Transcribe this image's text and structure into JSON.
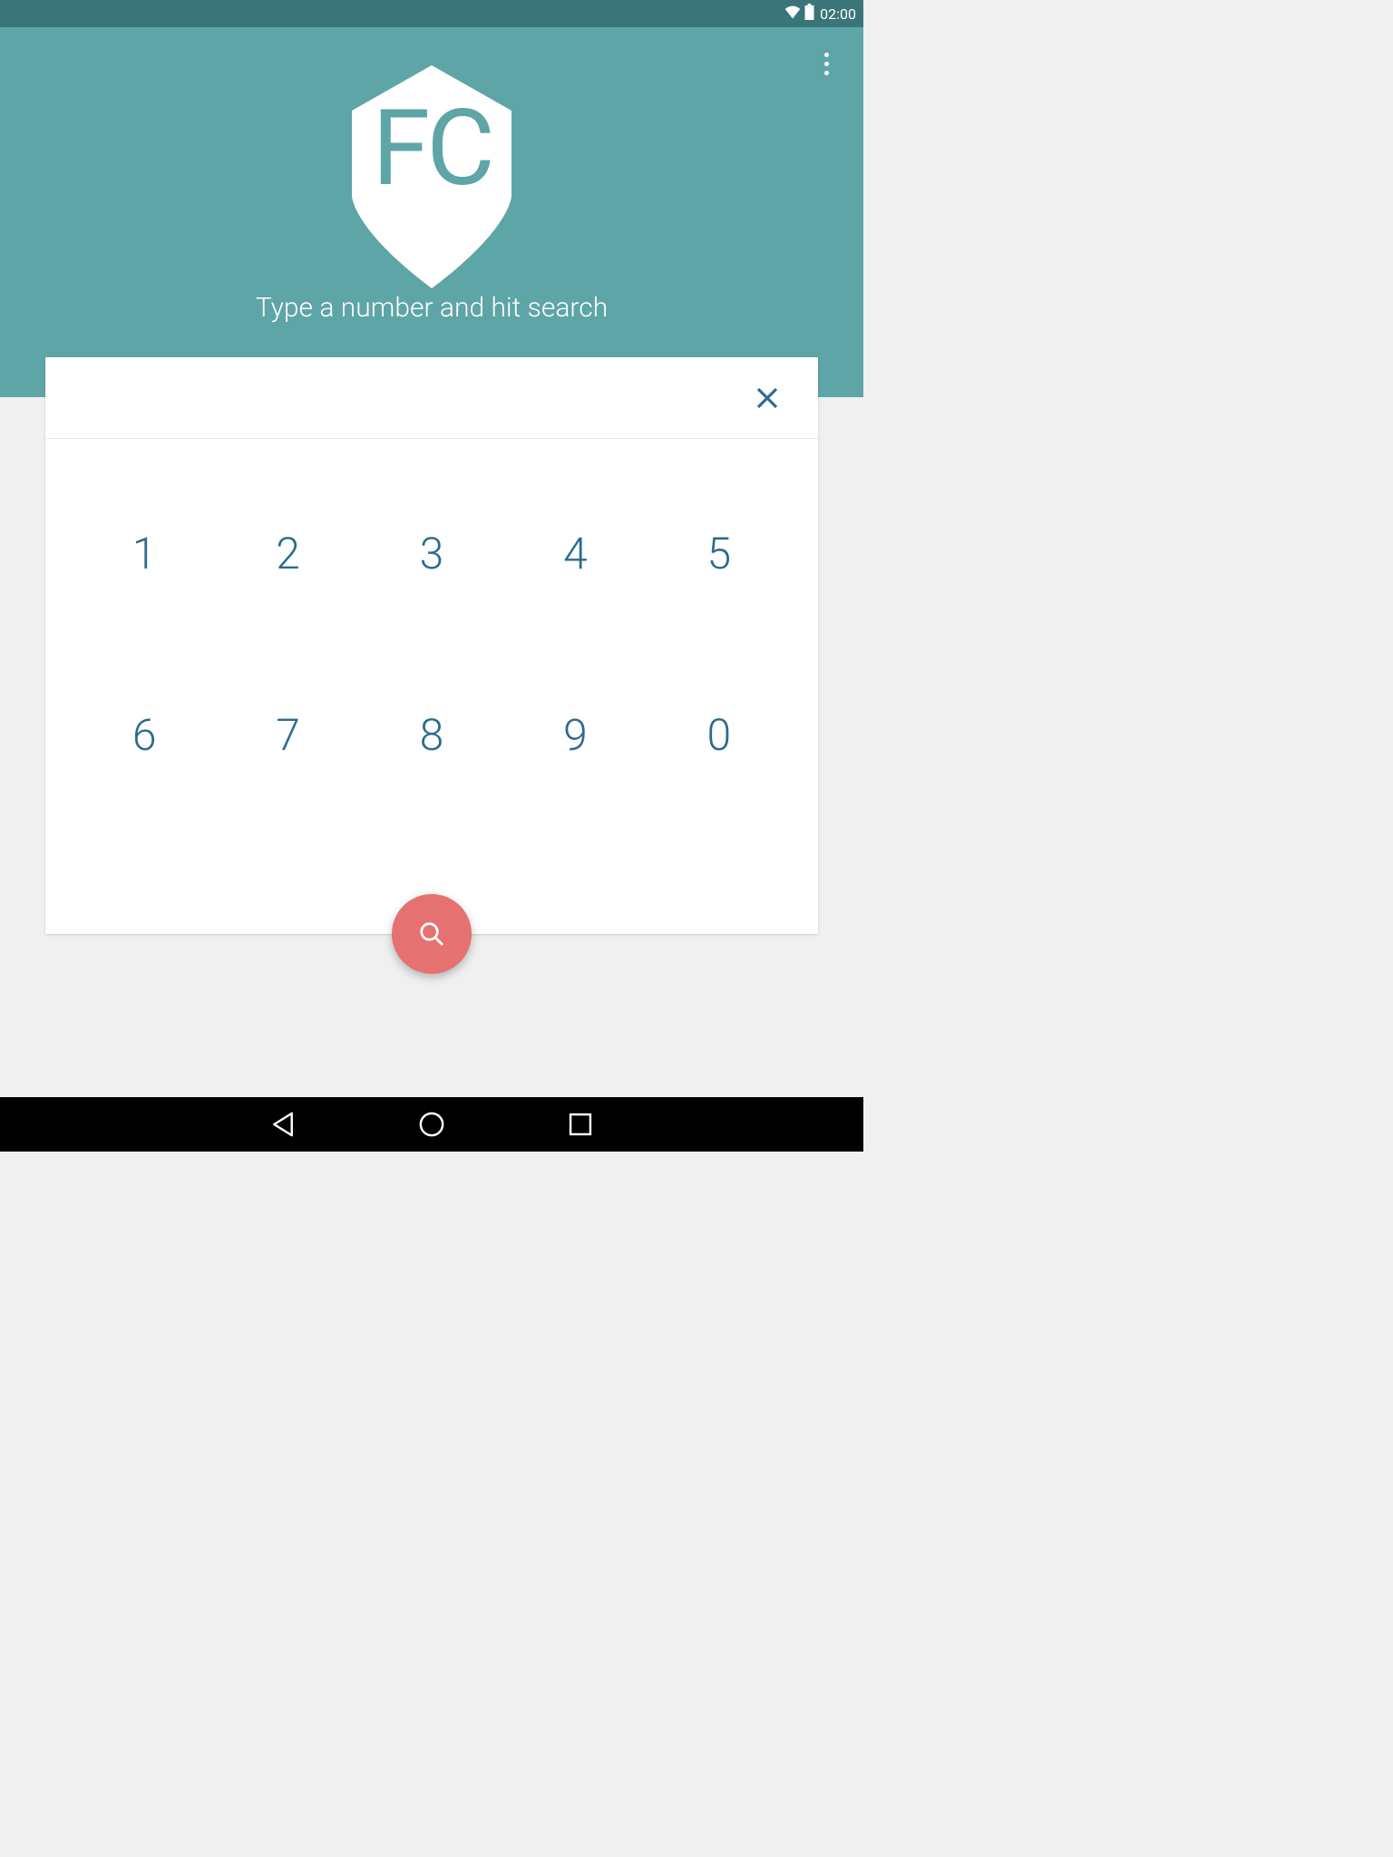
{
  "statusbar": {
    "time": "02:00"
  },
  "header": {
    "logo_text": "FC",
    "prompt": "Type a number and hit search"
  },
  "input": {
    "value": ""
  },
  "keypad": {
    "keys": [
      "1",
      "2",
      "3",
      "4",
      "5",
      "6",
      "7",
      "8",
      "9",
      "0"
    ]
  },
  "colors": {
    "primary": "#5ea5a7",
    "primary_dark": "#3a7579",
    "accent": "#e57171",
    "key_text": "#2b6b8e"
  }
}
